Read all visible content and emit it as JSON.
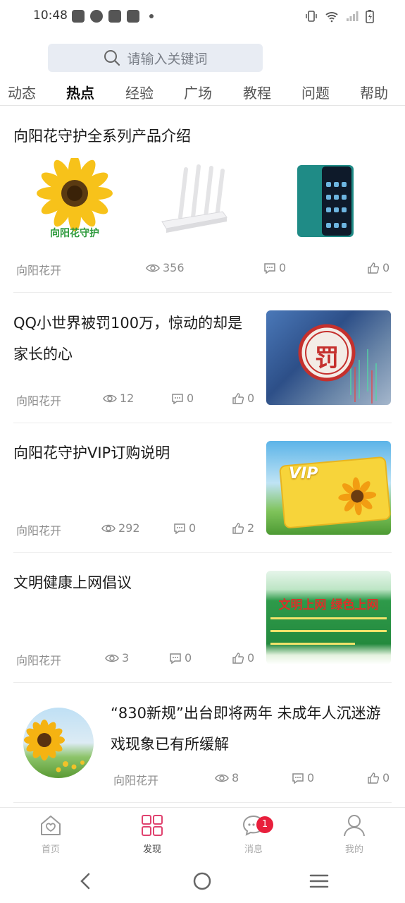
{
  "status_bar": {
    "time": "10:48"
  },
  "search": {
    "placeholder": "请输入关键词"
  },
  "tabs": [
    {
      "label": "动态"
    },
    {
      "label": "热点"
    },
    {
      "label": "经验"
    },
    {
      "label": "广场"
    },
    {
      "label": "教程"
    },
    {
      "label": "问题"
    },
    {
      "label": "帮助"
    }
  ],
  "active_tab": "热点",
  "feed": [
    {
      "title": "向阳花守护全系列产品介绍",
      "author": "向阳花开",
      "views": "356",
      "comments": "0",
      "likes": "0",
      "images": [
        "sunflower-logo",
        "router",
        "phone"
      ],
      "logo_text": "向阳花守护"
    },
    {
      "title": "QQ小世界被罚100万，惊动的却是家长的心",
      "author": "向阳花开",
      "views": "12",
      "comments": "0",
      "likes": "0",
      "thumb_text": "罚"
    },
    {
      "title": "向阳花守护VIP订购说明",
      "author": "向阳花开",
      "views": "292",
      "comments": "0",
      "likes": "2",
      "thumb_text": "VIP"
    },
    {
      "title": "文明健康上网倡议",
      "author": "向阳花开",
      "views": "3",
      "comments": "0",
      "likes": "0",
      "thumb_text": "文明上网 绿色上网"
    },
    {
      "title": "“830新规”出台即将两年 未成年人沉迷游戏现象已有所缓解",
      "author": "向阳花开",
      "views": "8",
      "comments": "0",
      "likes": "0"
    }
  ],
  "bottom_nav": [
    {
      "label": "首页"
    },
    {
      "label": "发现"
    },
    {
      "label": "消息",
      "badge": "1"
    },
    {
      "label": "我的"
    }
  ],
  "colors": {
    "accent": "#e0426f",
    "badge": "#e81f3c"
  }
}
